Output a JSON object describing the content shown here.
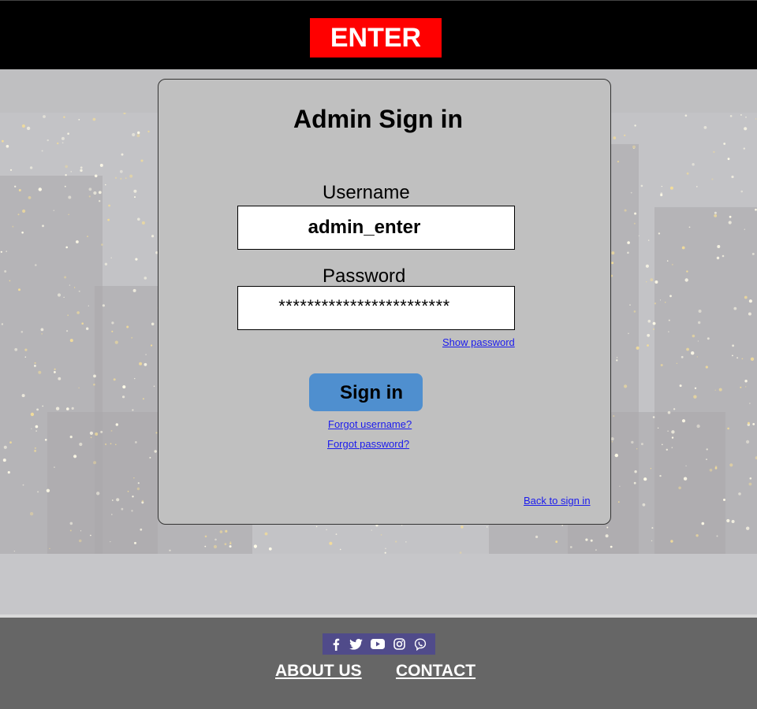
{
  "header": {
    "logo_text": "ENTER"
  },
  "form": {
    "title": "Admin Sign in",
    "username_label": "Username",
    "username_value": "admin_enter",
    "password_label": "Password",
    "password_value": "************************",
    "show_password_link": "Show password",
    "signin_button": "Sign in",
    "forgot_username_link": "Forgot username?",
    "forgot_password_link": "Forgot password?",
    "back_link": "Back to sign in"
  },
  "footer": {
    "social_icons": [
      "facebook-icon",
      "twitter-icon",
      "youtube-icon",
      "instagram-icon",
      "viber-icon"
    ],
    "about_link": "ABOUT US",
    "contact_link": "CONTACT"
  },
  "colors": {
    "header_bg": "#000000",
    "logo_bg": "#ff0000",
    "card_bg": "#c0c0c0",
    "button_bg": "#4f8fcf",
    "footer_bg": "#666666",
    "social_bg": "#504b8a",
    "link": "#1a1aee"
  }
}
